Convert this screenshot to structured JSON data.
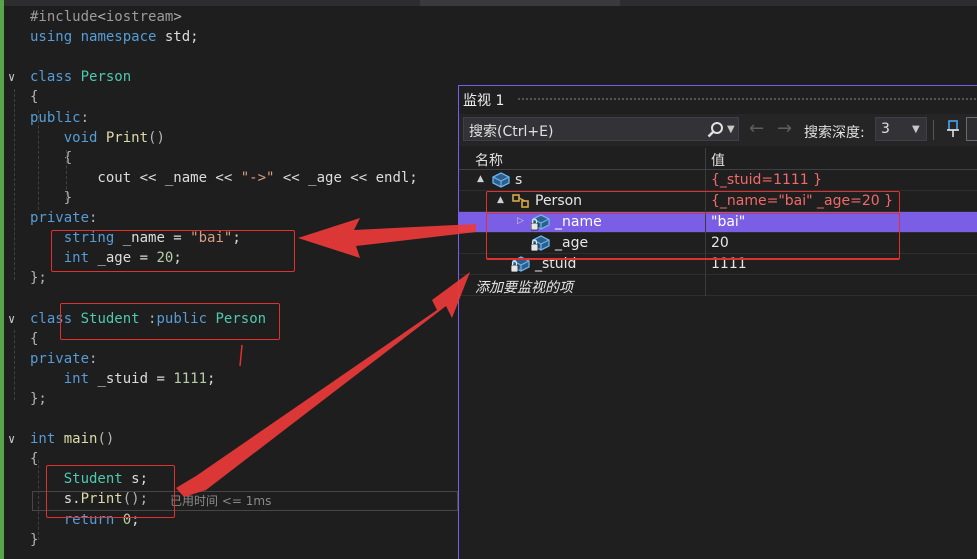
{
  "editor": {
    "lines": [
      {
        "tokens": [
          {
            "t": "#include",
            "c": "pp"
          },
          {
            "t": "<",
            "c": "pu"
          },
          {
            "t": "iostream",
            "c": "pp"
          },
          {
            "t": ">",
            "c": "pu"
          }
        ]
      },
      {
        "tokens": [
          {
            "t": "using",
            "c": "kw"
          },
          {
            "t": " ",
            "c": "id"
          },
          {
            "t": "namespace",
            "c": "kw"
          },
          {
            "t": " std;",
            "c": "id"
          }
        ]
      },
      {
        "tokens": []
      },
      {
        "tokens": [
          {
            "t": "class",
            "c": "kw"
          },
          {
            "t": " ",
            "c": "id"
          },
          {
            "t": "Person",
            "c": "ty"
          }
        ]
      },
      {
        "tokens": [
          {
            "t": "{",
            "c": "pu"
          }
        ]
      },
      {
        "tokens": [
          {
            "t": "public",
            "c": "kw"
          },
          {
            "t": ":",
            "c": "pu"
          }
        ]
      },
      {
        "tokens": [
          {
            "t": "    ",
            "c": "id"
          },
          {
            "t": "void",
            "c": "kw"
          },
          {
            "t": " ",
            "c": "id"
          },
          {
            "t": "Print",
            "c": "fn"
          },
          {
            "t": "()",
            "c": "pu"
          }
        ]
      },
      {
        "tokens": [
          {
            "t": "    {",
            "c": "pu"
          }
        ]
      },
      {
        "tokens": [
          {
            "t": "        cout << _name << ",
            "c": "id"
          },
          {
            "t": "\"->\"",
            "c": "st"
          },
          {
            "t": " << _age << endl;",
            "c": "id"
          }
        ]
      },
      {
        "tokens": [
          {
            "t": "    }",
            "c": "pu"
          }
        ]
      },
      {
        "tokens": [
          {
            "t": "private",
            "c": "kw"
          },
          {
            "t": ":",
            "c": "pu"
          }
        ]
      },
      {
        "tokens": [
          {
            "t": "    ",
            "c": "id"
          },
          {
            "t": "string",
            "c": "kw"
          },
          {
            "t": " _name = ",
            "c": "id"
          },
          {
            "t": "\"bai\"",
            "c": "st"
          },
          {
            "t": ";",
            "c": "id"
          }
        ]
      },
      {
        "tokens": [
          {
            "t": "    ",
            "c": "id"
          },
          {
            "t": "int",
            "c": "kw"
          },
          {
            "t": " _age = ",
            "c": "id"
          },
          {
            "t": "20",
            "c": "nm"
          },
          {
            "t": ";",
            "c": "id"
          }
        ]
      },
      {
        "tokens": [
          {
            "t": "};",
            "c": "pu"
          }
        ]
      },
      {
        "tokens": []
      },
      {
        "tokens": [
          {
            "t": "class",
            "c": "kw"
          },
          {
            "t": " ",
            "c": "id"
          },
          {
            "t": "Student",
            "c": "ty"
          },
          {
            "t": " :",
            "c": "pu"
          },
          {
            "t": "public",
            "c": "kw"
          },
          {
            "t": " ",
            "c": "id"
          },
          {
            "t": "Person",
            "c": "ty"
          }
        ]
      },
      {
        "tokens": [
          {
            "t": "{",
            "c": "pu"
          }
        ]
      },
      {
        "tokens": [
          {
            "t": "private",
            "c": "kw"
          },
          {
            "t": ":",
            "c": "pu"
          }
        ]
      },
      {
        "tokens": [
          {
            "t": "    ",
            "c": "id"
          },
          {
            "t": "int",
            "c": "kw"
          },
          {
            "t": " _stuid = ",
            "c": "id"
          },
          {
            "t": "1111",
            "c": "nm"
          },
          {
            "t": ";",
            "c": "id"
          }
        ]
      },
      {
        "tokens": [
          {
            "t": "};",
            "c": "pu"
          }
        ]
      },
      {
        "tokens": []
      },
      {
        "tokens": [
          {
            "t": "int",
            "c": "kw"
          },
          {
            "t": " ",
            "c": "id"
          },
          {
            "t": "main",
            "c": "fn"
          },
          {
            "t": "()",
            "c": "pu"
          }
        ]
      },
      {
        "tokens": [
          {
            "t": "{",
            "c": "pu"
          }
        ]
      },
      {
        "tokens": [
          {
            "t": "    ",
            "c": "id"
          },
          {
            "t": "Student",
            "c": "ty"
          },
          {
            "t": " s;",
            "c": "id"
          }
        ]
      },
      {
        "tokens": [
          {
            "t": "    s.",
            "c": "id"
          },
          {
            "t": "Print",
            "c": "fn"
          },
          {
            "t": "();",
            "c": "pu"
          }
        ]
      },
      {
        "tokens": [
          {
            "t": "    ",
            "c": "id"
          },
          {
            "t": "return",
            "c": "kw"
          },
          {
            "t": " ",
            "c": "id"
          },
          {
            "t": "0",
            "c": "nm"
          },
          {
            "t": ";",
            "c": "id"
          }
        ]
      },
      {
        "tokens": [
          {
            "t": "}",
            "c": "pu"
          }
        ]
      }
    ],
    "elapsed_hint": "已用时间 <= 1ms"
  },
  "watch": {
    "title": "监视 1",
    "search_placeholder": "搜索(Ctrl+E)",
    "depth_label": "搜索深度:",
    "depth_value": "3",
    "col_name": "名称",
    "col_value": "值",
    "rows": [
      {
        "name": "s",
        "value": "{_stuid=1111 }",
        "changed": true,
        "exp": "▲",
        "icon": "object-icon"
      },
      {
        "name": "Person",
        "value": "{_name=\"bai\" _age=20 }",
        "changed": true,
        "exp": "▲",
        "icon": "base-class-icon"
      },
      {
        "name": "_name",
        "value": "\"bai\"",
        "changed": false,
        "exp": "▷",
        "icon": "private-field-icon"
      },
      {
        "name": "_age",
        "value": "20",
        "changed": false,
        "exp": "",
        "icon": "private-field-icon"
      },
      {
        "name": "_stuid",
        "value": "1111",
        "changed": false,
        "exp": "",
        "icon": "private-field-icon"
      }
    ],
    "add_item_placeholder": "添加要监视的项"
  },
  "colors": {
    "accent": "#7a5fe6",
    "annotation": "#e03030",
    "changed_value": "#f06a6a"
  }
}
